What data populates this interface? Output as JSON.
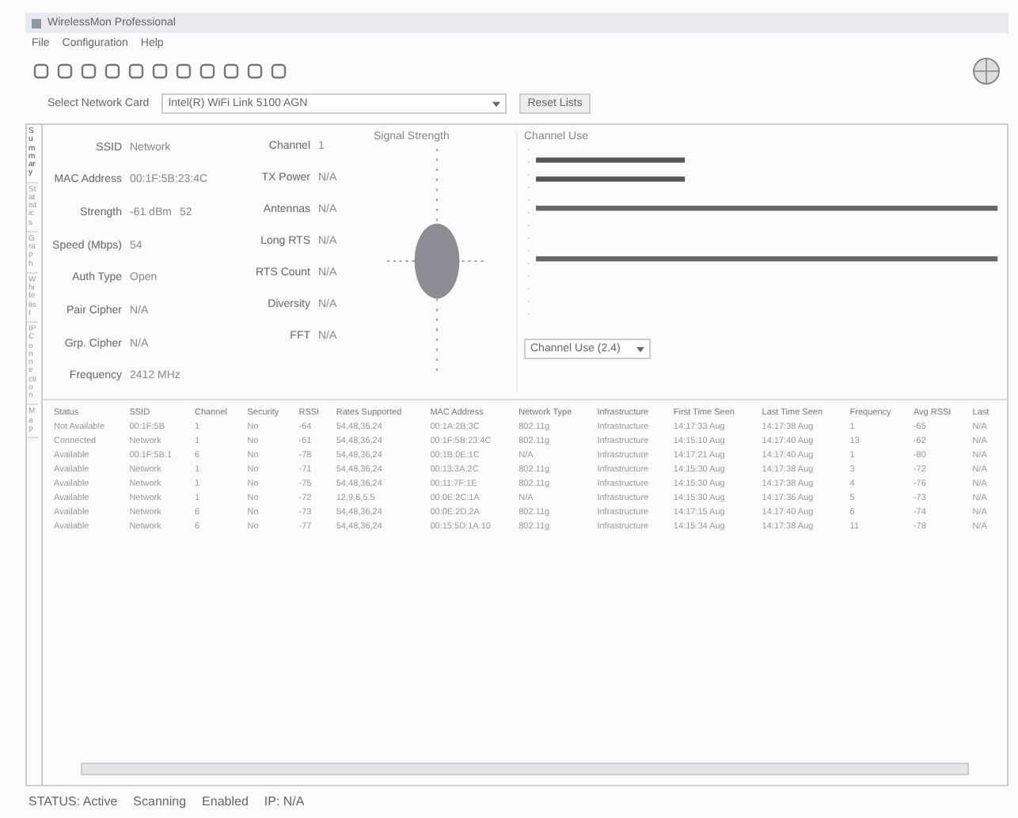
{
  "window": {
    "title": "WirelessMon Professional"
  },
  "menu": [
    "File",
    "Configuration",
    "Help"
  ],
  "card": {
    "label": "Select Network Card",
    "value": "Intel(R) WiFi Link 5100 AGN",
    "button": "Reset Lists"
  },
  "side_tabs": [
    {
      "label": "Summary",
      "selected": true
    },
    {
      "label": "Statistics",
      "selected": false
    },
    {
      "label": "Graph",
      "selected": false
    },
    {
      "label": "Whitelist",
      "selected": false
    },
    {
      "label": "IP Connection",
      "selected": false
    },
    {
      "label": "Map",
      "selected": false
    }
  ],
  "info": [
    {
      "label": "SSID",
      "value": "Network"
    },
    {
      "label": "MAC Address",
      "value": "00:1F:5B:23:4C"
    },
    {
      "label": "Strength",
      "value": "-61 dBm",
      "extra": "52"
    },
    {
      "label": "Speed (Mbps)",
      "value": "54"
    },
    {
      "label": "Auth Type",
      "value": "Open"
    },
    {
      "label": "Pair Cipher",
      "value": "N/A"
    },
    {
      "label": "Grp. Cipher",
      "value": "N/A"
    },
    {
      "label": "Frequency",
      "value": "2412 MHz"
    }
  ],
  "info2": [
    {
      "label": "Channel",
      "value": "1"
    },
    {
      "label": "TX Power",
      "value": "N/A"
    },
    {
      "label": "Antennas",
      "value": "N/A"
    },
    {
      "label": "Long RTS",
      "value": "N/A"
    },
    {
      "label": "RTS Count",
      "value": "N/A"
    },
    {
      "label": "Diversity",
      "value": "N/A"
    },
    {
      "label": "FFT",
      "value": "N/A"
    }
  ],
  "signal_panel": {
    "title": "Signal Strength"
  },
  "channel_panel": {
    "title": "Channel Use",
    "select": "Channel Use (2.4)"
  },
  "table": {
    "columns": [
      "Status",
      "SSID",
      "Channel",
      "Security",
      "RSSI",
      "Rates Supported",
      "MAC Address",
      "Network Type",
      "Infrastructure",
      "First Time Seen",
      "Last Time Seen",
      "Frequency",
      "Avg RSSI",
      "Last"
    ],
    "rows": [
      [
        "Not Available",
        "00:1F:5B",
        "1",
        "No",
        "-64",
        "54,48,36,24",
        "00:1A:2B:3C",
        "802.11g",
        "Infrastructure",
        "14:17:33 Aug",
        "14:17:38 Aug",
        "1",
        "-65",
        "N/A"
      ],
      [
        "Connected",
        "Network",
        "1",
        "No",
        "-61",
        "54,48,36,24",
        "00:1F:5B:23:4C",
        "802.11g",
        "Infrastructure",
        "14:15:10 Aug",
        "14:17:40 Aug",
        "13",
        "-62",
        "N/A"
      ],
      [
        "Available",
        "00:1F:5B:1",
        "6",
        "No",
        "-78",
        "54,48,36,24",
        "00:1B:0E:1C",
        "N/A",
        "Infrastructure",
        "14:17:21 Aug",
        "14:17:40 Aug",
        "1",
        "-80",
        "N/A"
      ],
      [
        "Available",
        "Network",
        "1",
        "No",
        "-71",
        "54,48,36,24",
        "00:13:3A:2C",
        "802.11g",
        "Infrastructure",
        "14:15:30 Aug",
        "14:17:38 Aug",
        "3",
        "-72",
        "N/A"
      ],
      [
        "Available",
        "Network",
        "1",
        "No",
        "-75",
        "54,48,36,24",
        "00:11:7F:1E",
        "802.11g",
        "Infrastructure",
        "14:15:30 Aug",
        "14:17:38 Aug",
        "4",
        "-76",
        "N/A"
      ],
      [
        "Available",
        "Network",
        "1",
        "No",
        "-72",
        "12,9,6,5.5",
        "00:0E:2C:1A",
        "N/A",
        "Infrastructure",
        "14:15:30 Aug",
        "14:17:36 Aug",
        "5",
        "-73",
        "N/A"
      ],
      [
        "Available",
        "Network",
        "6",
        "No",
        "-73",
        "54,48,36,24",
        "00:0E:2D:2A",
        "802.11g",
        "Infrastructure",
        "14:17:15 Aug",
        "14:17:40 Aug",
        "6",
        "-74",
        "N/A"
      ],
      [
        "Available",
        "Network",
        "6",
        "No",
        "-77",
        "54,48,36,24",
        "00:15:5D:1A:10",
        "802.11g",
        "Infrastructure",
        "14:15:34 Aug",
        "14:17:38 Aug",
        "11",
        "-78",
        "N/A"
      ]
    ]
  },
  "status_bar": [
    "STATUS: Active",
    "Scanning",
    "Enabled",
    "IP: N/A"
  ]
}
